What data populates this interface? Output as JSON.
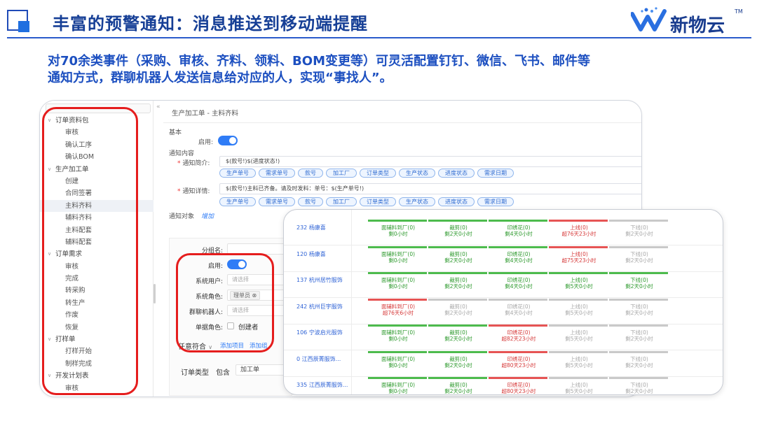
{
  "header": {
    "title": "丰富的预警通知：消息推送到移动端提醒",
    "logo_text": "新物云",
    "logo_tm": "TM"
  },
  "description": {
    "line1": "对70余类事件（采购、审核、齐料、领料、BOM变更等）可灵活配置钉钉、微信、飞书、邮件等",
    "line2": "通知方式，群聊机器人发送信息给对应的人，实现“事找人”。"
  },
  "colors": {
    "title": "#163f96",
    "description": "#1c4fc0",
    "highlight_box": "#e51d1d",
    "toggle": "#2f7cf6",
    "stage_done": "#4dbb4d",
    "stage_overdue": "#e65454",
    "stage_pending": "#c9c9c9"
  },
  "sidebar": {
    "items": [
      {
        "label": "订单资料包",
        "type": "group"
      },
      {
        "label": "审核",
        "type": "sub"
      },
      {
        "label": "确认工序",
        "type": "sub"
      },
      {
        "label": "确认BOM",
        "type": "sub"
      },
      {
        "label": "生产加工单",
        "type": "group"
      },
      {
        "label": "创建",
        "type": "sub"
      },
      {
        "label": "合同签署",
        "type": "sub"
      },
      {
        "label": "主料齐料",
        "type": "sub",
        "active": true
      },
      {
        "label": "辅料齐料",
        "type": "sub"
      },
      {
        "label": "主料配套",
        "type": "sub"
      },
      {
        "label": "辅料配套",
        "type": "sub"
      },
      {
        "label": "订单需求",
        "type": "group"
      },
      {
        "label": "审核",
        "type": "sub"
      },
      {
        "label": "完成",
        "type": "sub"
      },
      {
        "label": "转采购",
        "type": "sub"
      },
      {
        "label": "转生产",
        "type": "sub"
      },
      {
        "label": "作废",
        "type": "sub"
      },
      {
        "label": "恢复",
        "type": "sub"
      },
      {
        "label": "打样单",
        "type": "group"
      },
      {
        "label": "打样开始",
        "type": "sub"
      },
      {
        "label": "制样完成",
        "type": "sub"
      },
      {
        "label": "开发计划表",
        "type": "group"
      },
      {
        "label": "审核",
        "type": "sub"
      }
    ]
  },
  "form": {
    "breadcrumb": "生产加工单 - 主料齐料",
    "section_basic": "基本",
    "enable_label": "启用:",
    "section_content": "通知内容",
    "brief_label": "通知简介:",
    "brief_template": "$(款号!)$(进度状态!)",
    "detail_label": "通知详情:",
    "detail_template": "$(款号!)主料已齐备。请及时发料：单号：$(生产单号!)",
    "field_tags": [
      "生产单号",
      "需求单号",
      "款号",
      "加工厂",
      "订单类型",
      "生产状态",
      "进度状态",
      "需求日期"
    ],
    "section_target": "通知对象",
    "add_link": "增加",
    "recipient": {
      "group_name_label": "分组名:",
      "enable_label": "启用:",
      "system_user_label": "系统用户:",
      "system_user_placeholder": "请选择",
      "system_role_label": "系统角色:",
      "system_role_chip": "理单员",
      "robot_label": "群聊机器人:",
      "robot_placeholder": "请选择",
      "doc_role_label": "单据角色:",
      "doc_role_option": "创建者",
      "match_label": "任意符合",
      "add_item": "添加项目",
      "add_group": "添加组",
      "order_type_label": "订单类型",
      "contains": "包含",
      "order_type_value": "加工单"
    }
  },
  "progress_board": {
    "stage_names": [
      "面辅料到厂(0)",
      "裁剪(0)",
      "印绣花(0)",
      "上线(0)",
      "下线(0)"
    ],
    "rows": [
      {
        "label": "232 杨康喜",
        "stages": [
          {
            "status": "green",
            "time": "剩0小时"
          },
          {
            "status": "green",
            "time": "剩2天0小时"
          },
          {
            "status": "green",
            "time": "剩4天0小时"
          },
          {
            "status": "red",
            "time": "超76天23小时"
          },
          {
            "status": "gray",
            "time": "剩2天0小时"
          }
        ]
      },
      {
        "label": "120 杨康喜",
        "stages": [
          {
            "status": "green",
            "time": "剩0小时"
          },
          {
            "status": "green",
            "time": "剩2天0小时"
          },
          {
            "status": "green",
            "time": "剩4天0小时"
          },
          {
            "status": "red",
            "time": "超75天23小时"
          },
          {
            "status": "gray",
            "time": "剩2天0小时"
          }
        ]
      },
      {
        "label": "137 杭州居竹服饰",
        "stages": [
          {
            "status": "green",
            "time": "剩0小时"
          },
          {
            "status": "green",
            "time": "剩2天0小时"
          },
          {
            "status": "green",
            "time": "剩4天0小时"
          },
          {
            "status": "green",
            "time": "剩5天0小时"
          },
          {
            "status": "green",
            "time": "剩2天0小时"
          }
        ]
      },
      {
        "label": "242 杭州巨宇服饰",
        "stages": [
          {
            "status": "red",
            "time": "超76天6小时"
          },
          {
            "status": "gray",
            "time": "剩2天0小时"
          },
          {
            "status": "gray",
            "time": "剩4天0小时"
          },
          {
            "status": "gray",
            "time": "剩5天0小时"
          },
          {
            "status": "gray",
            "time": "剩2天0小时"
          }
        ]
      },
      {
        "label": "106 宁波启元服饰",
        "stages": [
          {
            "status": "green",
            "time": "剩0小时"
          },
          {
            "status": "green",
            "time": "剩2天0小时"
          },
          {
            "status": "red",
            "time": "超82天23小时"
          },
          {
            "status": "gray",
            "time": "剩5天0小时"
          },
          {
            "status": "gray",
            "time": "剩2天0小时"
          }
        ]
      },
      {
        "label": "0 江西辰菁服饰...",
        "stages": [
          {
            "status": "green",
            "time": "剩0小时"
          },
          {
            "status": "green",
            "time": "剩2天0小时"
          },
          {
            "status": "red",
            "time": "超80天23小时"
          },
          {
            "status": "gray",
            "time": "剩5天0小时"
          },
          {
            "status": "gray",
            "time": "剩2天0小时"
          }
        ]
      },
      {
        "label": "335 江西辰菁服饰...",
        "stages": [
          {
            "status": "green",
            "time": "剩0小时"
          },
          {
            "status": "green",
            "time": "剩2天0小时"
          },
          {
            "status": "red",
            "time": "超80天23小时"
          },
          {
            "status": "gray",
            "time": "剩5天0小时"
          },
          {
            "status": "gray",
            "time": "剩2天0小时"
          }
        ]
      }
    ]
  }
}
